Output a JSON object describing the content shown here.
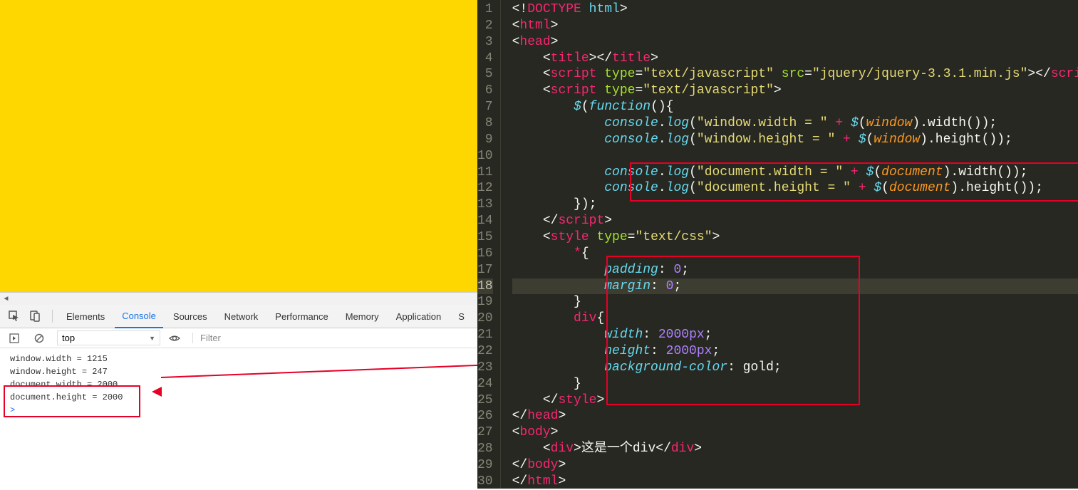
{
  "left": {
    "tabs": {
      "elements": "Elements",
      "console": "Console",
      "sources": "Sources",
      "network": "Network",
      "performance": "Performance",
      "memory": "Memory",
      "application": "Application",
      "security": "S"
    },
    "context": "top",
    "filter_placeholder": "Filter",
    "lines": {
      "l1": "window.width = 1215",
      "l2": "window.height = 247",
      "l3": "document.width = 2000",
      "l4": "document.height = 2000"
    },
    "prompt": ">"
  },
  "gutter": [
    "1",
    "2",
    "3",
    "4",
    "5",
    "6",
    "7",
    "8",
    "9",
    "10",
    "11",
    "12",
    "13",
    "14",
    "15",
    "16",
    "17",
    "18",
    "19",
    "20",
    "21",
    "22",
    "23",
    "24",
    "25",
    "26",
    "27",
    "28",
    "29",
    "30"
  ],
  "code": {
    "doctype_open": "<!",
    "doctype_word": "DOCTYPE",
    "doctype_val": " html",
    "doctype_close": ">",
    "html_open": "<",
    "html_tag": "html",
    "gt": ">",
    "head_tag": "head",
    "title_tag": "title",
    "close": "</",
    "script_tag": "script",
    "type_attr": " type",
    "eq": "=",
    "type_val": "\"text/javascript\"",
    "src_attr": " src",
    "src_val": "\"jquery/jquery-3.3.1.min.js\"",
    "jq": "$",
    "fn": "function",
    "paren": "()",
    "brace": "{",
    "console": "console",
    "dot": ".",
    "log": "log",
    "open_p": "(",
    "win_w": "\"window.width = \"",
    "plus": " + ",
    "window": "window",
    "width_m": ".width()",
    "win_h": "\"window.height = \"",
    "height_m": ".height()",
    "doc_w": "\"document.width = \"",
    "document": "document",
    "doc_h": "\"document.height = \"",
    "style_tag": "style",
    "css_attr": " type",
    "css_val": "\"text/css\"",
    "star": "*",
    "pad": "padding",
    "zero": "0",
    "semi": ";",
    "marg": "margin",
    "div_sel": "div",
    "wprop": "width",
    "px2000": "2000px",
    "hprop": "height",
    "bgprop": "background-color",
    "gold": "gold",
    "body_tag": "body",
    "div_tag": "div",
    "div_text": "这是一个div",
    "close_brace": "}",
    "close_p": ")",
    "close_semi": ");"
  }
}
